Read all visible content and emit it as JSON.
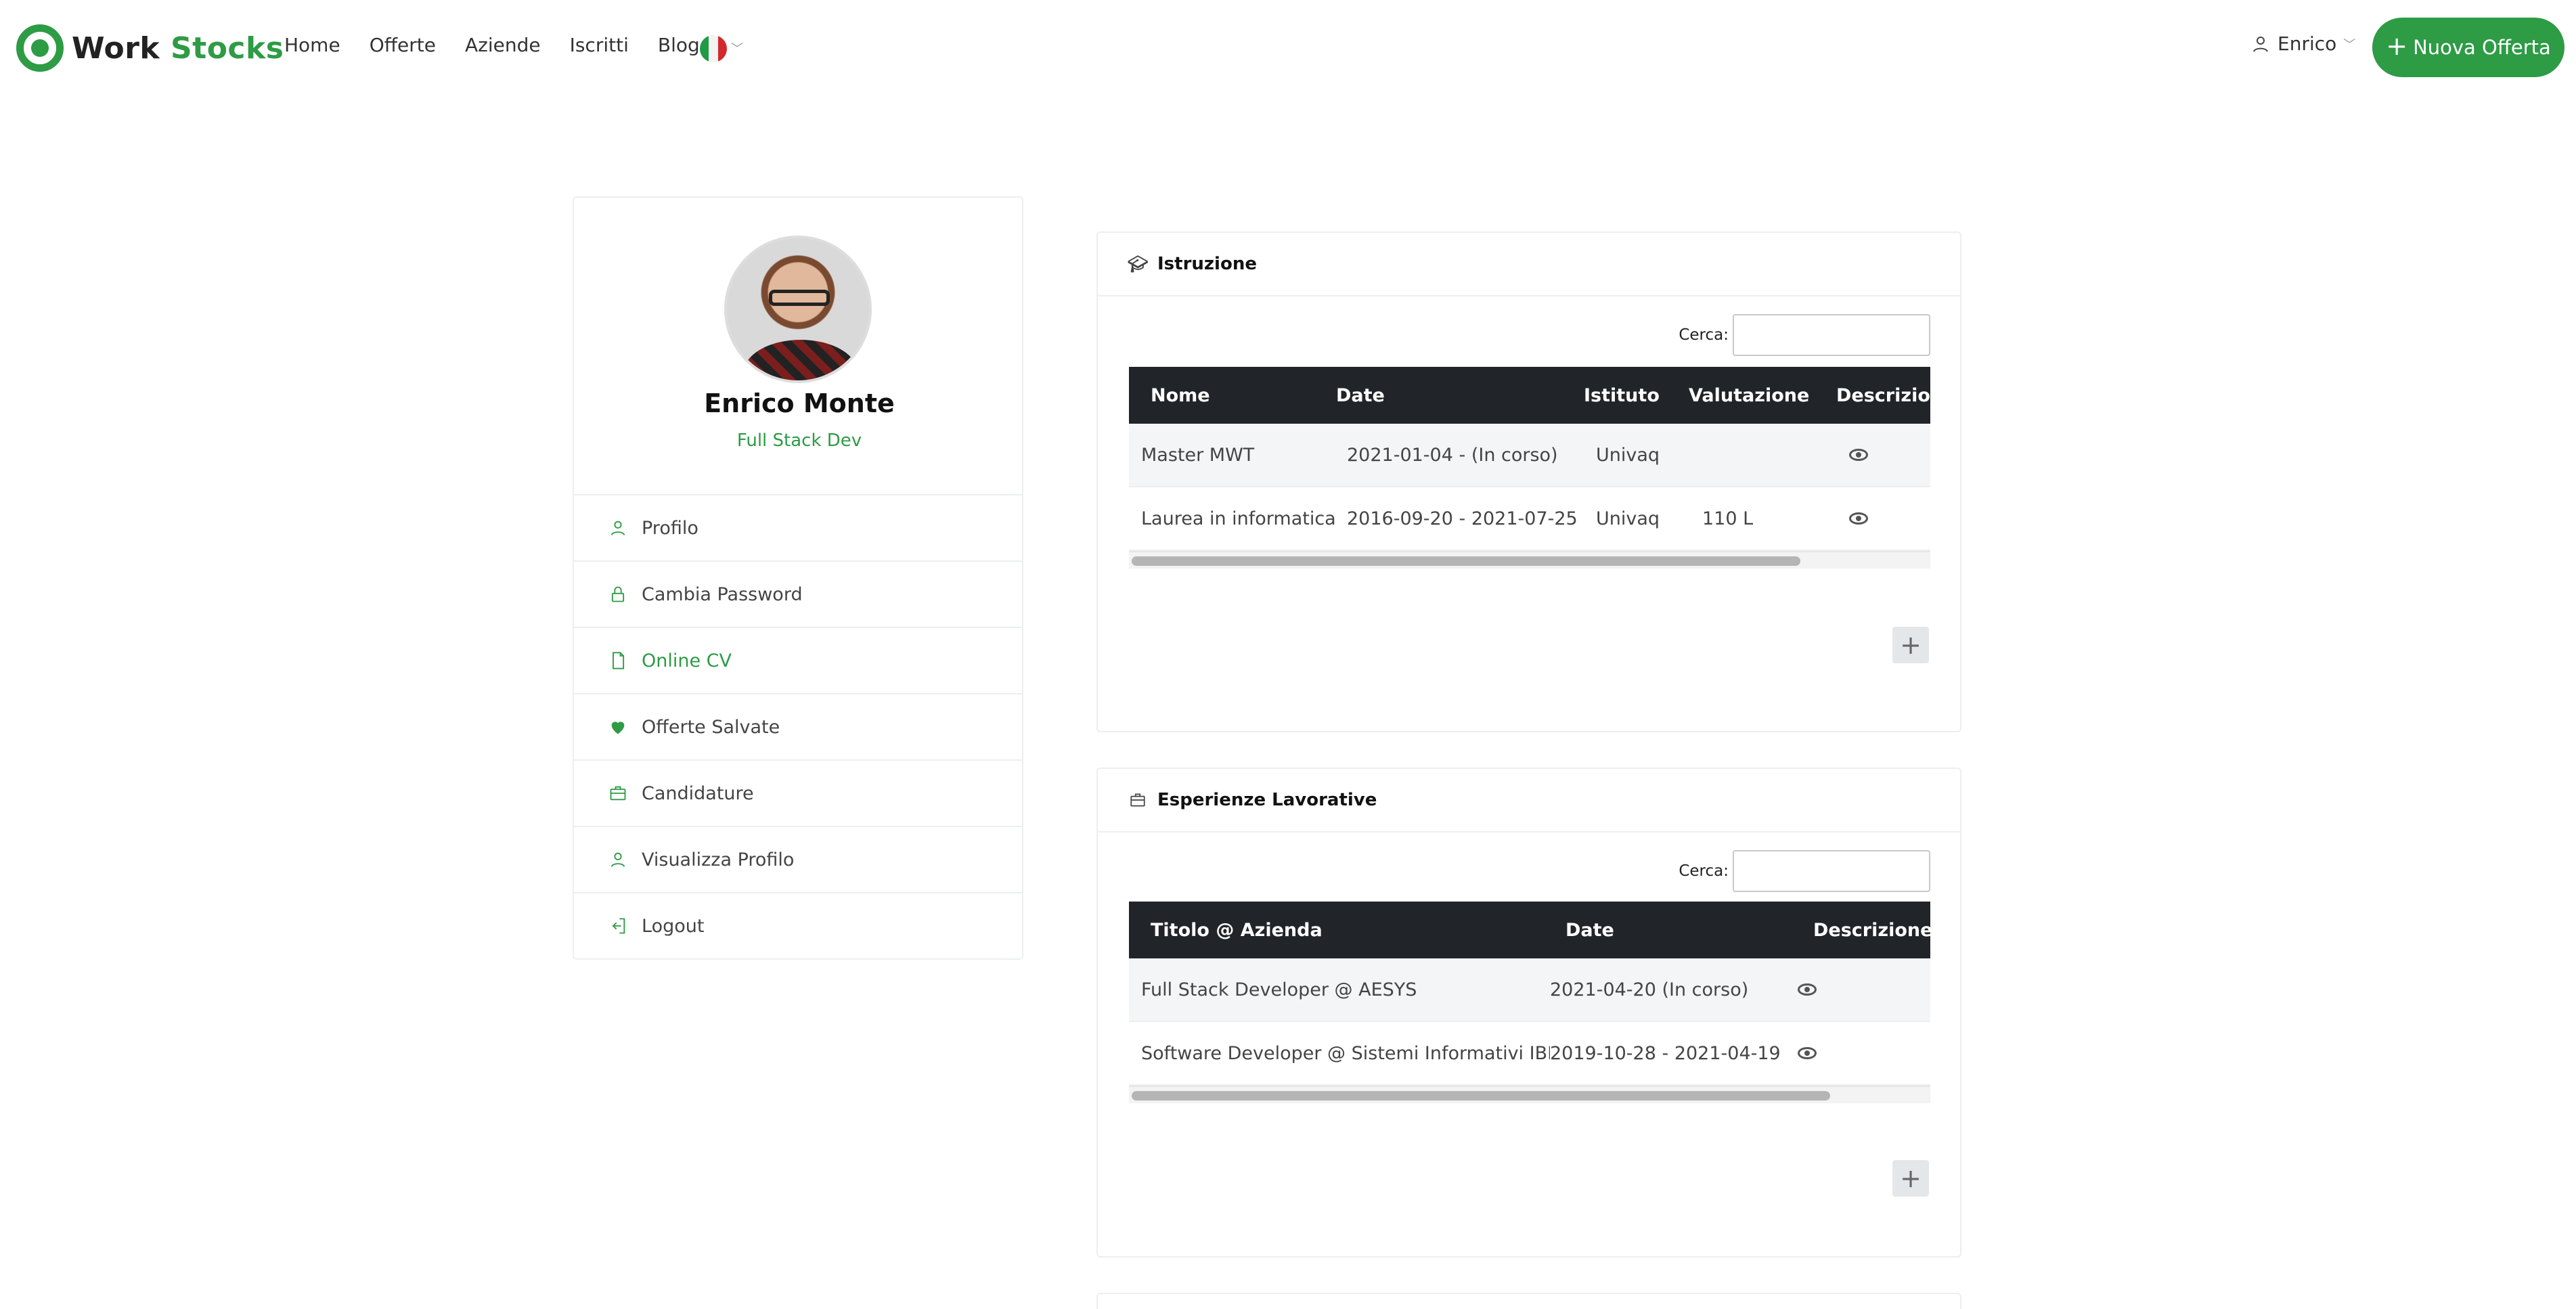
{
  "brand": {
    "word1": "Work",
    "word2": "Stocks"
  },
  "nav": [
    "Home",
    "Offerte",
    "Aziende",
    "Iscritti",
    "Blog"
  ],
  "user_menu": {
    "name": "Enrico"
  },
  "new_offer": {
    "label": "Nuova Offerta"
  },
  "profile": {
    "name": "Enrico Monte",
    "role": "Full Stack Dev"
  },
  "sidebar_menu": [
    {
      "label": "Profilo",
      "icon": "user-icon"
    },
    {
      "label": "Cambia Password",
      "icon": "lock-icon"
    },
    {
      "label": "Online CV",
      "icon": "file-icon",
      "active": true
    },
    {
      "label": "Offerte Salvate",
      "icon": "heart-icon"
    },
    {
      "label": "Candidature",
      "icon": "briefcase-icon"
    },
    {
      "label": "Visualizza Profilo",
      "icon": "user-icon"
    },
    {
      "label": "Logout",
      "icon": "logout-icon"
    }
  ],
  "education": {
    "title": "Istruzione",
    "search_label": "Cerca:",
    "columns": [
      "Nome",
      "Date",
      "Istituto",
      "Valutazione",
      "Descrizione"
    ],
    "rows": [
      {
        "nome": "Master MWT",
        "date": "2021-01-04 - (In corso)",
        "istituto": "Univaq",
        "valutazione": ""
      },
      {
        "nome": "Laurea in informatica",
        "date": "2016-09-20 - 2021-07-25",
        "istituto": "Univaq",
        "valutazione": "110 L"
      }
    ],
    "add_label": "+"
  },
  "experience": {
    "title": "Esperienze Lavorative",
    "search_label": "Cerca:",
    "columns": [
      "Titolo @ Azienda",
      "Date",
      "Descrizione"
    ],
    "rows": [
      {
        "titolo": "Full Stack Developer @ AESYS",
        "date": "2021-04-20 (In corso)"
      },
      {
        "titolo": "Software Developer @ Sistemi Informativi IBM",
        "date": "2019-10-28 - 2021-04-19"
      }
    ],
    "add_label": "+"
  },
  "colors": {
    "accent": "#2e9b45",
    "table_header": "#212529"
  }
}
